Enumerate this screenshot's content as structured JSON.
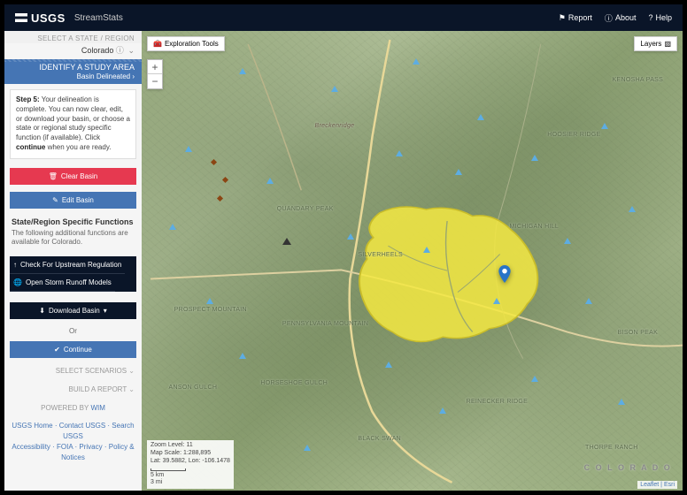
{
  "header": {
    "logo_text": "USGS",
    "app_name": "StreamStats",
    "links": {
      "report": "Report",
      "about": "About",
      "help": "Help"
    }
  },
  "sidebar": {
    "state_section": {
      "label": "SELECT A STATE / REGION",
      "value": "Colorado"
    },
    "study_area": {
      "label": "IDENTIFY A STUDY AREA",
      "status": "Basin Delineated"
    },
    "step": {
      "label": "Step 5:",
      "text": "Your delineation is complete. You can now clear, edit, or download your basin, or choose a state or regional study specific function (if available). Click ",
      "bold": "continue",
      "text2": " when you are ready."
    },
    "buttons": {
      "clear_basin": "Clear Basin",
      "edit_basin": "Edit Basin",
      "check_upstream": "Check For Upstream Regulation",
      "storm_runoff": "Open Storm Runoff Models",
      "download_basin": "Download Basin",
      "continue": "Continue"
    },
    "functions": {
      "title": "State/Region Specific Functions",
      "desc": "The following additional functions are available for Colorado."
    },
    "or": "Or",
    "collapse": {
      "scenarios": "SELECT SCENARIOS",
      "report": "BUILD A REPORT"
    },
    "powered": {
      "prefix": "POWERED BY",
      "link": "WIM"
    },
    "footer": {
      "usgs_home": "USGS Home",
      "contact": "Contact USGS",
      "search": "Search USGS",
      "accessibility": "Accessibility",
      "foia": "FOIA",
      "privacy": "Privacy",
      "policy": "Policy & Notices"
    }
  },
  "map": {
    "exploration_tools": "Exploration Tools",
    "layers": "Layers",
    "labels": {
      "breckenridge": "Breckenridge",
      "quandary": "QUANDARY PEAK",
      "silverheels": "SILVERHEELS",
      "michigan": "MICHIGAN HILL",
      "colorado": "C O L O R A D O",
      "pennsylvania": "PENNSYLVANIA MOUNTAIN",
      "prospect": "PROSPECT MOUNTAIN",
      "blackswan": "BLACK SWAN",
      "anson": "ANSON GULCH",
      "hoosier": "HOOSIER RIDGE",
      "reinecker": "REINECKER RIDGE",
      "thorpe": "THORPE RANCH",
      "bisonpeak": "BISON PEAK",
      "kenosha": "KENOSHA PASS",
      "horseshoe": "HORSESHOE GULCH"
    },
    "info": {
      "zoom": "Zoom Level: 11",
      "scale": "Map Scale: 1:288,895",
      "coords": "Lat: 39.5882, Lon: -106.1478",
      "dist_km": "5 km",
      "dist_mi": "3 mi"
    },
    "attribution": {
      "leaflet": "Leaflet",
      "esri": "Esri"
    },
    "colors": {
      "basin": "#f5e942",
      "marker": "#2874c7",
      "btn_red": "#e63950",
      "btn_blue": "#4575b4",
      "btn_dark": "#0a1528"
    }
  }
}
